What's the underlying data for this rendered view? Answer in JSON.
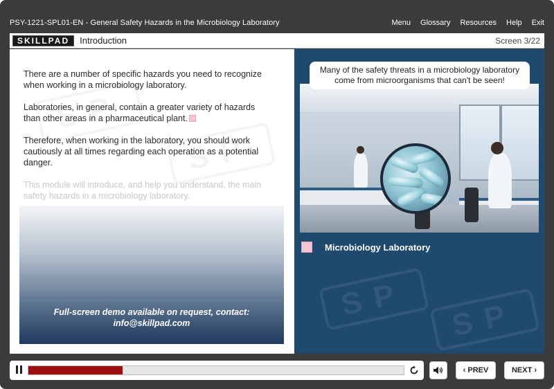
{
  "topbar": {
    "title": "PSY-1221-SPL01-EN - General Safety Hazards in the Microbiology Laboratory",
    "nav": [
      "Menu",
      "Glossary",
      "Resources",
      "Help",
      "Exit"
    ]
  },
  "header": {
    "logo": "SKILLPAD",
    "section": "Introduction",
    "screen": "Screen 3/22"
  },
  "left": {
    "paragraphs": [
      "There are a number of specific hazards you need to recognize when working in a microbiology laboratory.",
      "Laboratories, in general, contain a greater variety of hazards than other areas in a pharmaceutical plant.",
      "Therefore, when working in the laboratory, you should work cautiously at all times regarding each operation as a potential danger.",
      "This module will introduce, and help you understand, the main safety hazards in a microbiology laboratory."
    ],
    "demo_line1": "Full-screen demo available on request, contact:",
    "demo_line2": "info@skillpad.com"
  },
  "right": {
    "callout_line1": "Many of the safety threats in a microbiology laboratory",
    "callout_line2": "come from microorganisms that can't be seen!",
    "photo_label": "Microbiology Laboratory"
  },
  "controls": {
    "progress": 0.25,
    "prev_label": "PREV",
    "next_label": "NEXT"
  },
  "colors": {
    "progress_fill": "#9b0f12",
    "right_panel": "#1f4a6e",
    "marker": "#f5c6d6"
  }
}
